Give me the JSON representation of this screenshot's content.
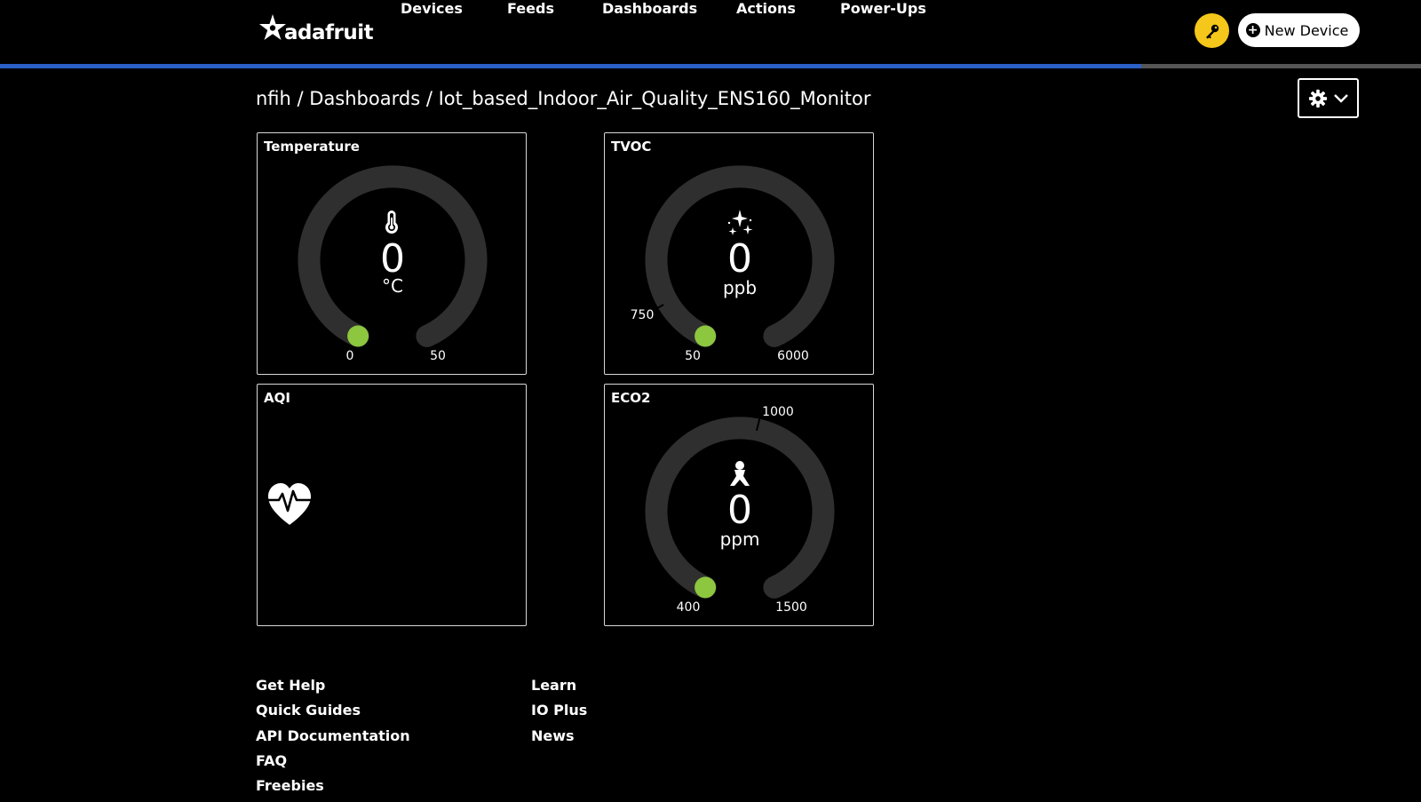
{
  "header": {
    "logo_text": "adafruit",
    "nav": [
      "Devices",
      "Feeds",
      "Dashboards",
      "Actions",
      "Power-Ups"
    ],
    "new_device_label": "New Device",
    "key_icon": "key-icon",
    "progress": 0.803
  },
  "breadcrumb": "nfih / Dashboards / Iot_based_Indoor_Air_Quality_ENS160_Monitor",
  "blocks": {
    "temperature": {
      "title": "Temperature",
      "value": "0",
      "unit": "°C",
      "min_label": "0",
      "max_label": "50",
      "icon": "thermometer-icon"
    },
    "tvoc": {
      "title": "TVOC",
      "value": "0",
      "unit": "ppb",
      "min_label": "50",
      "max_label": "6000",
      "mark_label": "750",
      "icon": "sparkles-icon"
    },
    "aqi": {
      "title": "AQI",
      "icon": "heart-pulse-icon"
    },
    "eco2": {
      "title": "ECO2",
      "value": "0",
      "unit": "ppm",
      "min_label": "400",
      "max_label": "1500",
      "mark_label": "1000",
      "icon": "person-icon"
    }
  },
  "colors": {
    "indicator": "#8dc63f",
    "track": "#2f2f2f",
    "accent": "#2b60c9",
    "key": "#f5c71a"
  },
  "footer": {
    "col1": [
      "Get Help",
      "Quick Guides",
      "API Documentation",
      "FAQ",
      "Freebies"
    ],
    "col2": [
      "Learn",
      "IO Plus",
      "News"
    ]
  }
}
